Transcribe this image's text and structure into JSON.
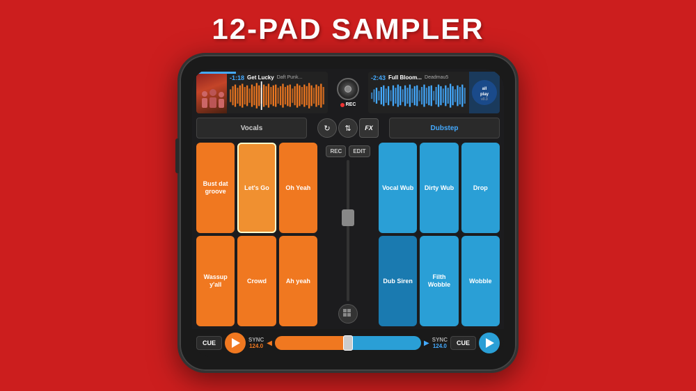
{
  "page": {
    "title": "12-PAD SAMPLER",
    "bg_color": "#cc1e1e"
  },
  "header": {
    "track_left": {
      "time": "-1:18",
      "name": "Get Lucky",
      "artist": "Daft Punk..."
    },
    "track_right": {
      "time": "-2:43",
      "name": "Full Bloom...",
      "artist": "Deadmau5"
    },
    "rec_label": "REC"
  },
  "deck_left": {
    "label": "Vocals"
  },
  "deck_right": {
    "label": "Dubstep"
  },
  "center_icons": {
    "sync_icon": "↻",
    "eq_icon": "⇅",
    "fx_label": "FX"
  },
  "pads_left": [
    {
      "label": "Bust dat groove",
      "type": "orange"
    },
    {
      "label": "Let's Go",
      "type": "orange-active"
    },
    {
      "label": "Oh Yeah",
      "type": "orange"
    },
    {
      "label": "Wassup y'all",
      "type": "orange"
    },
    {
      "label": "Crowd",
      "type": "orange"
    },
    {
      "label": "Ah yeah",
      "type": "orange"
    }
  ],
  "pads_right": [
    {
      "label": "Vocal Wub",
      "type": "blue"
    },
    {
      "label": "Dirty Wub",
      "type": "blue"
    },
    {
      "label": "Drop",
      "type": "blue"
    },
    {
      "label": "Dub Siren",
      "type": "blue-dark"
    },
    {
      "label": "Filth Wobble",
      "type": "blue"
    },
    {
      "label": "Wobble",
      "type": "blue"
    }
  ],
  "center_controls": {
    "rec_label": "REC",
    "edit_label": "EDIT"
  },
  "bottom_left": {
    "cue": "CUE",
    "sync": "SYNC",
    "bpm": "124.0"
  },
  "bottom_right": {
    "cue": "CUE",
    "sync": "SYNC",
    "bpm": "124.0"
  }
}
